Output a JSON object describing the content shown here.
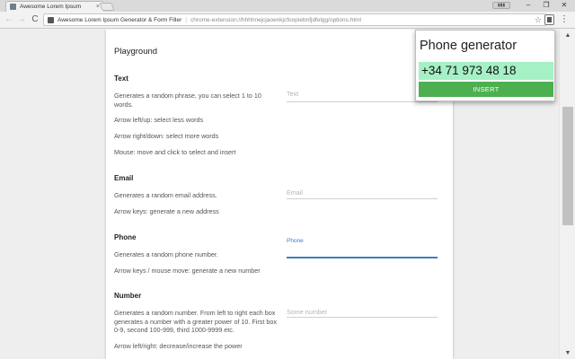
{
  "browser": {
    "tab_title": "Awesome Lorem Ipsum",
    "tab_close": "×",
    "profile_label": "▮▮▮",
    "window_controls": {
      "minimize": "–",
      "restore": "❐",
      "close": "✕"
    },
    "nav": {
      "back": "←",
      "forward": "→",
      "reload": "C"
    },
    "omnibox": {
      "title": "Awesome Lorem Ipsum Generator & Form Filler",
      "separator": "|",
      "url": "chrome-extension://hhhhnejcjaoenkjcfoopiebnfjdfelgg/options.html"
    },
    "star": "☆",
    "menu": "⋮"
  },
  "page": {
    "title": "Playground",
    "sections": [
      {
        "title": "Text",
        "descriptions": [
          "Generates a random phrase, you can select 1 to 10 words.",
          "Arrow left/up: select less words",
          "Arrow right/down: select more words",
          "Mouse: move and click to select and insert"
        ],
        "field_label": "Text"
      },
      {
        "title": "Email",
        "descriptions": [
          "Generates a random email address.",
          "Arrow keys: generate a new address"
        ],
        "field_label": "Email"
      },
      {
        "title": "Phone",
        "descriptions": [
          "Generates a random phone number.",
          "Arrow keys / mouse move: generate a new number"
        ],
        "field_label": "Phone"
      },
      {
        "title": "Number",
        "descriptions": [
          "Generates a random number. From left to right each box generates a number with a greater power of 10. First box 0-9, second 100-999, third 1000-9999 etc.",
          "Arrow left/right: decrease/increase the power"
        ],
        "field_label": "Some number"
      }
    ]
  },
  "scrollbar": {
    "up": "▲",
    "down": "▼"
  },
  "popup": {
    "title": "Phone generator",
    "phone_value": "+34 71 973 48 18",
    "insert_label": "INSERT"
  },
  "colors": {
    "accent": "#3b7fc4",
    "insert_button": "#4caf50",
    "phone_highlight": "#a6f0c6"
  }
}
